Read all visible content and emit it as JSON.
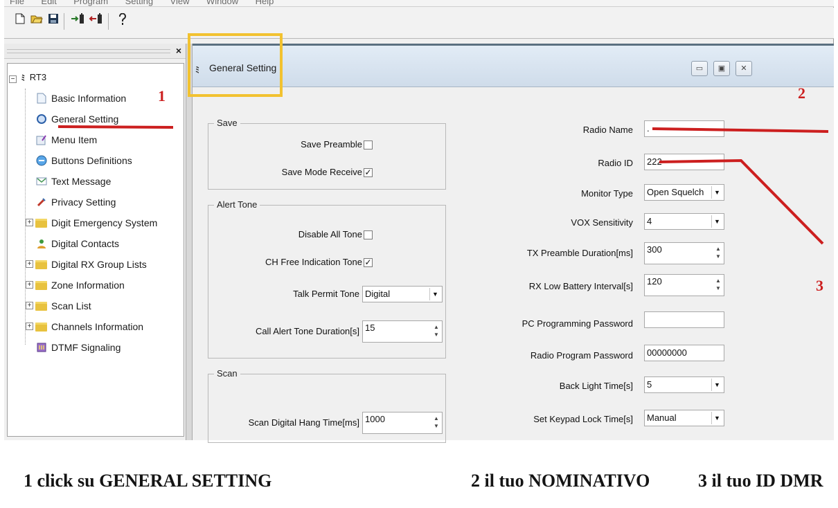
{
  "menu": [
    "File",
    "Edit",
    "Program",
    "Setting",
    "View",
    "Window",
    "Help"
  ],
  "toolbar": {
    "icons": [
      "new-file-icon",
      "open-file-icon",
      "save-icon",
      "read-radio-icon",
      "write-radio-icon",
      "help-icon"
    ]
  },
  "panel": {
    "close_glyph": "×"
  },
  "tree": {
    "root": "RT3",
    "items": [
      {
        "label": "Basic Information",
        "icon": "document-icon"
      },
      {
        "label": "General Setting",
        "icon": "general-setting-icon"
      },
      {
        "label": "Menu Item",
        "icon": "menu-item-icon"
      },
      {
        "label": "Buttons Definitions",
        "icon": "buttons-icon"
      },
      {
        "label": "Text Message",
        "icon": "text-message-icon"
      },
      {
        "label": "Privacy Setting",
        "icon": "privacy-icon"
      },
      {
        "label": "Digit Emergency System",
        "icon": "folder-icon"
      },
      {
        "label": "Digital Contacts",
        "icon": "contacts-icon"
      },
      {
        "label": "Digital RX Group Lists",
        "icon": "folder-icon"
      },
      {
        "label": "Zone Information",
        "icon": "folder-icon"
      },
      {
        "label": "Scan List",
        "icon": "folder-icon"
      },
      {
        "label": "Channels Information",
        "icon": "folder-icon"
      },
      {
        "label": "DTMF Signaling",
        "icon": "dtmf-icon"
      }
    ]
  },
  "child_window": {
    "title": "General Setting"
  },
  "save_group": {
    "legend": "Save",
    "save_preamble": {
      "label": "Save Preamble",
      "checked": false
    },
    "save_mode_receive": {
      "label": "Save Mode Receive",
      "checked": true
    }
  },
  "alert_group": {
    "legend": "Alert Tone",
    "disable_all_tone": {
      "label": "Disable All Tone",
      "checked": false
    },
    "ch_free_indication_tone": {
      "label": "CH Free Indication Tone",
      "checked": true
    },
    "talk_permit_tone": {
      "label": "Talk Permit Tone",
      "value": "Digital"
    },
    "call_alert_tone_duration": {
      "label": "Call Alert Tone Duration[s]",
      "value": "15"
    }
  },
  "scan_group": {
    "legend": "Scan",
    "scan_digital_hang_time": {
      "label": "Scan Digital Hang Time[ms]",
      "value": "1000"
    }
  },
  "right_fields": {
    "radio_name": {
      "label": "Radio Name",
      "value": "."
    },
    "radio_id": {
      "label": "Radio ID",
      "value": "222"
    },
    "monitor_type": {
      "label": "Monitor Type",
      "value": "Open Squelch"
    },
    "vox_sensitivity": {
      "label": "VOX Sensitivity",
      "value": "4"
    },
    "tx_preamble_duration": {
      "label": "TX Preamble Duration[ms]",
      "value": "300"
    },
    "rx_low_battery_interval": {
      "label": "RX Low Battery Interval[s]",
      "value": "120"
    },
    "pc_programming_password": {
      "label": "PC Programming Password",
      "value": ""
    },
    "radio_program_password": {
      "label": "Radio Program Password",
      "value": "00000000"
    },
    "back_light_time": {
      "label": "Back Light Time[s]",
      "value": "5"
    },
    "keypad_lock_time": {
      "label": "Set Keypad Lock Time[s]",
      "value": "Manual"
    }
  },
  "annotations": {
    "num1": "1",
    "num2": "2",
    "num3": "3",
    "caption1": "1 click su GENERAL SETTING",
    "caption2": "2 il tuo NOMINATIVO",
    "caption3": "3  il tuo  ID DMR",
    "marker_color": "#cc1f1f",
    "highlight_color": "#f2c230"
  }
}
